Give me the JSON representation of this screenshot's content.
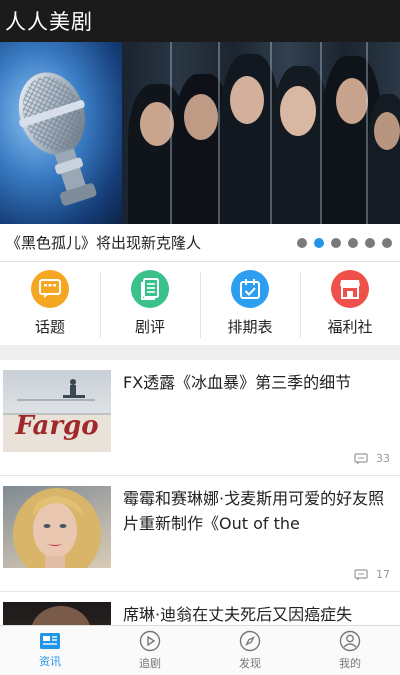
{
  "app": {
    "title": "人人美剧"
  },
  "banner": {
    "caption": "《黑色孤儿》将出现新克隆人",
    "dots": 6,
    "active_dot": 1
  },
  "categories": [
    {
      "label": "话题",
      "icon": "chat-icon",
      "color": "#f5a623"
    },
    {
      "label": "剧评",
      "icon": "document-icon",
      "color": "#3ac18c"
    },
    {
      "label": "排期表",
      "icon": "calendar-check-icon",
      "color": "#2e9ff0"
    },
    {
      "label": "福利社",
      "icon": "shop-icon",
      "color": "#f0504a"
    }
  ],
  "news": [
    {
      "title": "FX透露《冰血暴》第三季的细节",
      "comments": "33",
      "thumb_text": "Fargo"
    },
    {
      "title": "霉霉和赛琳娜·戈麦斯用可爱的好友照片重新制作《Out of the",
      "comments": "17"
    },
    {
      "title": "席琳·迪翁在丈夫死后又因癌症失",
      "comments": ""
    }
  ],
  "tabs": [
    {
      "label": "资讯",
      "icon": "news-icon",
      "active": true
    },
    {
      "label": "追剧",
      "icon": "play-icon",
      "active": false
    },
    {
      "label": "发现",
      "icon": "compass-icon",
      "active": false
    },
    {
      "label": "我的",
      "icon": "user-icon",
      "active": false
    }
  ],
  "colors": {
    "accent": "#2196e8",
    "titlebar": "#1b1b1b"
  }
}
